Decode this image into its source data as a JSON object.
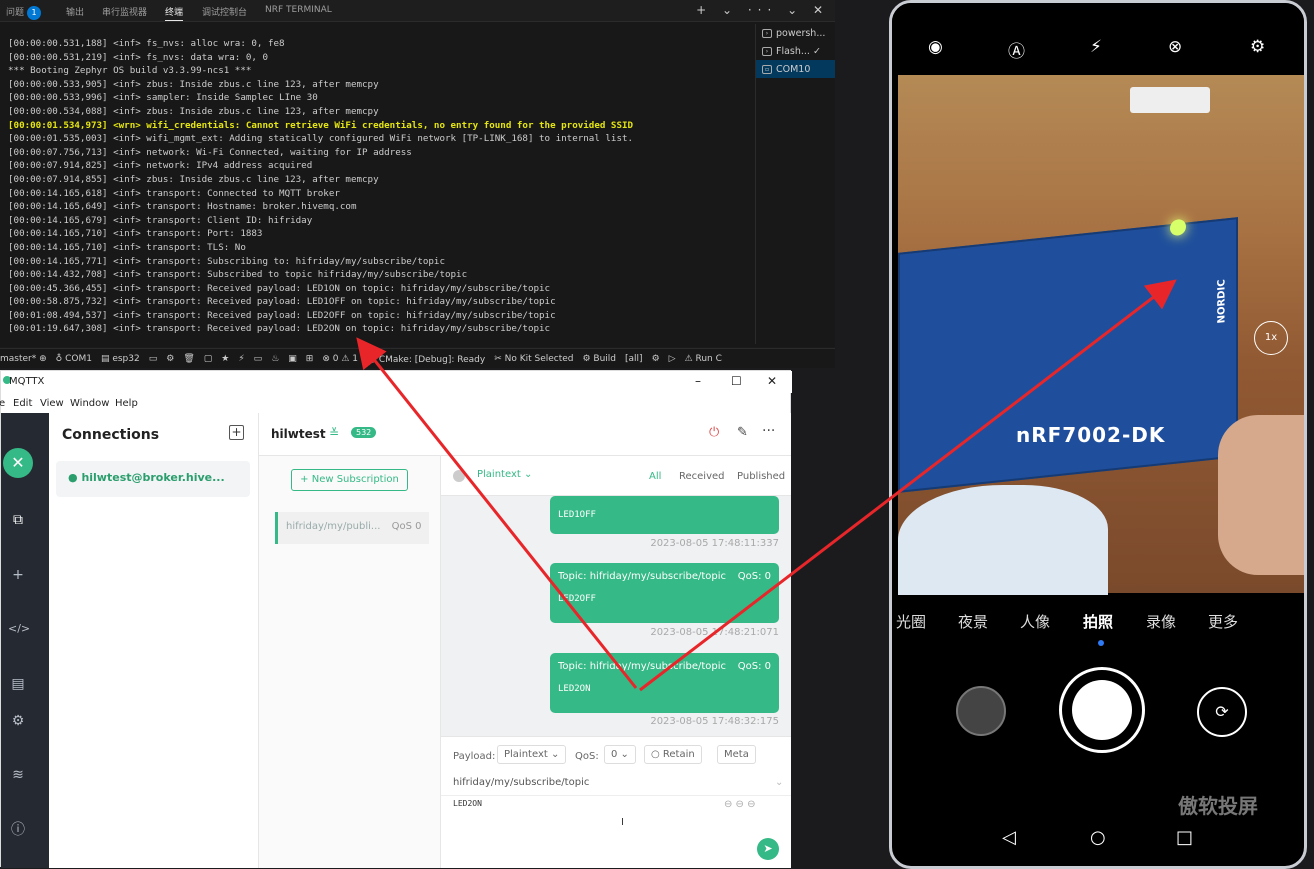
{
  "terminal": {
    "tabs": [
      {
        "label": "问题",
        "badge": "1"
      },
      {
        "label": "输出"
      },
      {
        "label": "串行监视器"
      },
      {
        "label": "终端",
        "active": true
      },
      {
        "label": "调试控制台"
      },
      {
        "label": "NRF TERMINAL"
      }
    ],
    "actions": "+ ⌄ ··· ⌄ ✕",
    "log_lines": [
      "[00:00:00.531,188] <inf> fs_nvs: alloc wra: 0, fe8",
      "[00:00:00.531,219] <inf> fs_nvs: data wra: 0, 0",
      "*** Booting Zephyr OS build v3.3.99-ncs1 ***",
      "[00:00:00.533,905] <inf> zbus: Inside zbus.c line 123, after memcpy",
      "[00:00:00.533,996] <inf> sampler: Inside Samplec LIne 30",
      "[00:00:00.534,088] <inf> zbus: Inside zbus.c line 123, after memcpy",
      "[00:00:01.534,973] <wrn> wifi_credentials: Cannot retrieve WiFi credentials, no entry found for the provided SSID",
      "[00:00:01.535,003] <inf> wifi_mgmt_ext: Adding statically configured WiFi network [TP-LINK_168] to internal list.",
      "[00:00:07.756,713] <inf> network: Wi-Fi Connected, waiting for IP address",
      "[00:00:07.914,825] <inf> network: IPv4 address acquired",
      "[00:00:07.914,855] <inf> zbus: Inside zbus.c line 123, after memcpy",
      "[00:00:14.165,618] <inf> transport: Connected to MQTT broker",
      "[00:00:14.165,649] <inf> transport: Hostname: broker.hivemq.com",
      "[00:00:14.165,679] <inf> transport: Client ID: hifriday",
      "[00:00:14.165,710] <inf> transport: Port: 1883",
      "[00:00:14.165,710] <inf> transport: TLS: No",
      "[00:00:14.165,771] <inf> transport: Subscribing to: hifriday/my/subscribe/topic",
      "[00:00:14.432,708] <inf> transport: Subscribed to topic hifriday/my/subscribe/topic",
      "[00:00:45.366,455] <inf> transport: Received payload: LED1ON on topic: hifriday/my/subscribe/topic",
      "[00:00:58.875,732] <inf> transport: Received payload: LED1OFF on topic: hifriday/my/subscribe/topic",
      "[00:01:08.494,537] <inf> transport: Received payload: LED2OFF on topic: hifriday/my/subscribe/topic",
      "[00:01:19.647,308] <inf> transport: Received payload: LED2ON on topic: hifriday/my/subscribe/topic"
    ],
    "warn_line_index": 6,
    "processes": [
      {
        "label": "powersh...",
        "icon": "terminal-icon"
      },
      {
        "label": "Flash... ✓",
        "icon": "task-icon"
      },
      {
        "label": "COM10",
        "icon": "serial-icon",
        "selected": true
      }
    ]
  },
  "statusbar": {
    "items": [
      "master* ⊕",
      "♁ COM1",
      "▤ esp32",
      "▭",
      "⚙",
      "🗑",
      "▢",
      "★",
      "⚡",
      "▭",
      "♨",
      "▣",
      "⊞",
      "⊗ 0 ⚠ 1",
      "ⓘ CMake: [Debug]: Ready",
      "✂ No Kit Selected",
      "⚙ Build",
      "[all]",
      "⚙",
      "▷",
      "⚠ Run C"
    ]
  },
  "mqttx": {
    "title": "MQTTX",
    "menu": [
      "e",
      "Edit",
      "View",
      "Window",
      "Help"
    ],
    "connections_title": "Connections",
    "connection_item": "hilwtest@broker.hive...",
    "conn_name": "hilwtest",
    "conn_badge": "532",
    "new_subscription": "+ New Subscription",
    "subscription": {
      "topic": "hifriday/my/publi...",
      "qos": "QoS 0"
    },
    "payload_format": "Plaintext",
    "filters": [
      "All",
      "Received",
      "Published"
    ],
    "messages": [
      {
        "topic": "",
        "payload": "LED1OFF",
        "time": "2023-08-05 17:48:11:337"
      },
      {
        "topic": "Topic: hifriday/my/subscribe/topic",
        "qos": "QoS: 0",
        "payload": "LED2OFF",
        "time": "2023-08-05 17:48:21:071"
      },
      {
        "topic": "Topic: hifriday/my/subscribe/topic",
        "qos": "QoS: 0",
        "payload": "LED2ON",
        "time": "2023-08-05 17:48:32:175"
      }
    ],
    "composer": {
      "payload_label": "Payload:",
      "payload_type": "Plaintext",
      "qos_label": "QoS:",
      "qos_value": "0",
      "retain": "Retain",
      "meta": "Meta",
      "topic": "hifriday/my/subscribe/topic",
      "message": "LED2ON"
    }
  },
  "phone": {
    "board_label": "nRF7002-DK",
    "brand": "NORDIC",
    "zoom": "1x",
    "modes": [
      "光圈",
      "夜景",
      "人像",
      "拍照",
      "录像",
      "更多"
    ],
    "current_mode": "拍照",
    "watermark": "傲软投屏"
  },
  "colors": {
    "accent": "#35b986",
    "vscode_status": "#181818",
    "arrow": "#e8262a",
    "board": "#1f4f9c"
  }
}
